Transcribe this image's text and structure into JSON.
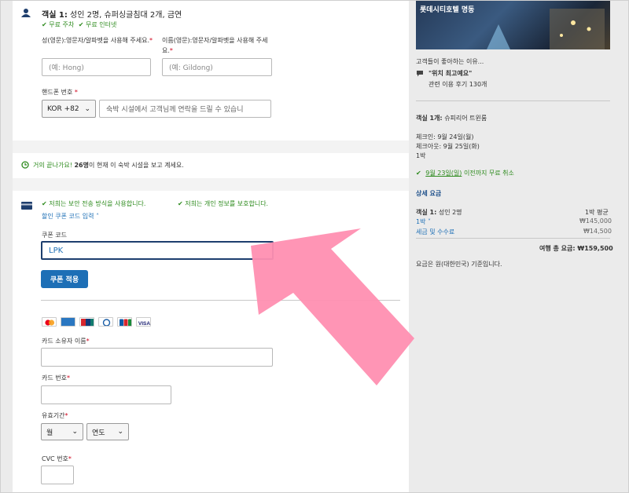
{
  "guest": {
    "room_title_prefix": "객실 1:",
    "room_title": "성인 2명, 슈퍼싱글침대 2개, 금연",
    "amenities": [
      "무료 주차",
      "무료 인터넷"
    ],
    "last_name_label": "성(영문):영문자/알파벳을 사용해 주세요.",
    "last_name_placeholder": "(예: Hong)",
    "first_name_label": "이름(영문):영문자/알파벳을 사용해 주세요.",
    "first_name_placeholder": "(예: Gildong)",
    "phone_label": "핸드폰 번호",
    "country_code": "KOR +82",
    "phone_placeholder": "숙박 시설에서 고객님께 연락을 드릴 수 있습니"
  },
  "urgency": {
    "prefix": "거의 끝나가요!",
    "count": "26명",
    "suffix": "이 현재 이 숙박 시설을 보고 계세요."
  },
  "payment": {
    "secure_notice_1": "저희는 보안 전송 방식을 사용합니다.",
    "secure_notice_2": "저희는 개인 정보를 보호합니다.",
    "coupon_toggle": "할인 쿠폰 코드 입력",
    "coupon_label": "쿠폰 코드",
    "coupon_value": "LPK",
    "coupon_button": "쿠폰 적용",
    "card_brands": [
      "mastercard",
      "amex",
      "unionpay",
      "diners",
      "jcb",
      "visa"
    ],
    "cardholder_label": "카드 소유자 이름",
    "card_number_label": "카드 번호",
    "expiry_label": "유효기간",
    "month_option": "월",
    "year_option": "연도",
    "cvc_label": "CVC 번호"
  },
  "summary": {
    "hotel_name": "롯데시티호텔 명동",
    "reviews_intro": "고객들이 좋아하는 이유...",
    "review_quote": "\"위치 최고예요\"",
    "review_count": "관련 이용 후기 130개",
    "room_line_prefix": "객실 1개:",
    "room_line": "슈피리어 트윈룸",
    "checkin": "체크인: 9월 24일(월)",
    "checkout": "체크아웃: 9월 25일(화)",
    "nights": "1박",
    "cancel_date": "9월 23일(일)",
    "cancel_suffix": "이전까지 무료 취소",
    "price_details_title": "상세 요금",
    "room_guests_prefix": "객실 1:",
    "room_guests": "성인 2명",
    "per_night_label": "1박 평균",
    "nights_link": "1박",
    "nights_price": "₩145,000",
    "tax_link": "세금 및 수수료",
    "tax_price": "₩14,500",
    "total_label": "여행 총 요금:",
    "total_price": "₩159,500",
    "currency_note": "요금은 원(대한민국) 기준입니다."
  },
  "colors": {
    "accent": "#1d6fb6",
    "green": "#2e8b1e",
    "required": "#d0021b",
    "arrow": "#ff8fb1"
  }
}
